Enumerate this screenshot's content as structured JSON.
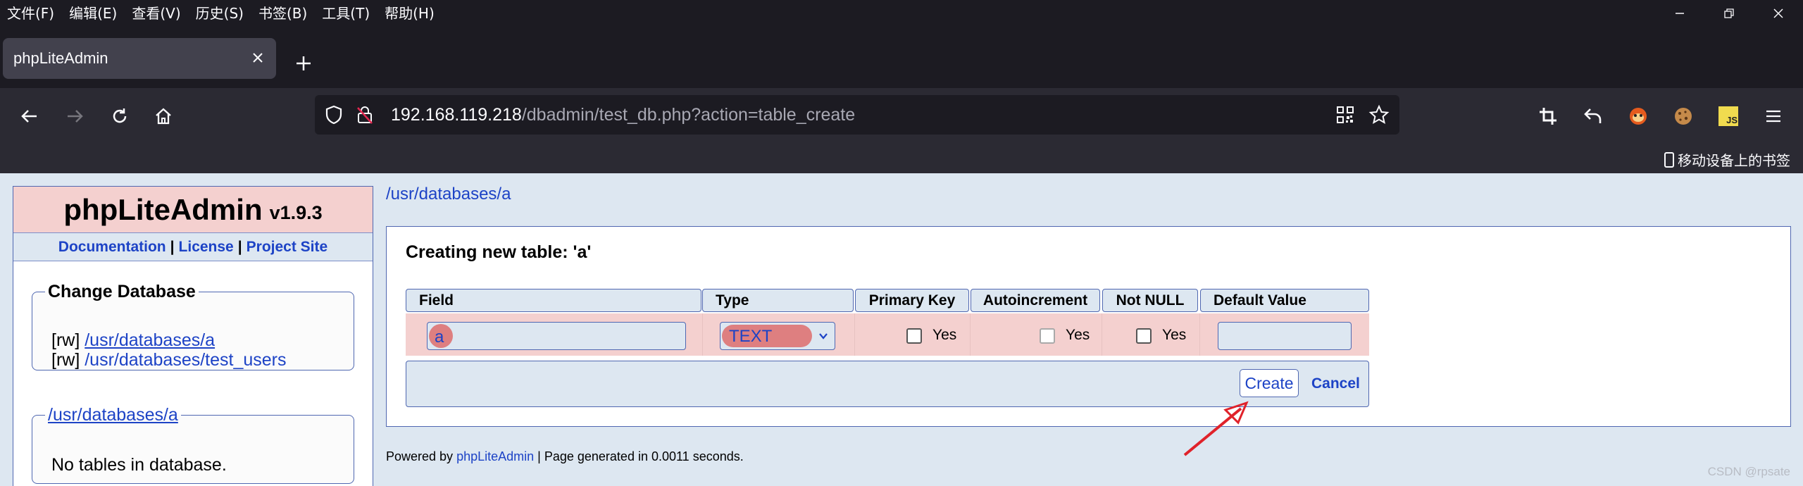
{
  "browser": {
    "menu": [
      "文件(F)",
      "编辑(E)",
      "查看(V)",
      "历史(S)",
      "书签(B)",
      "工具(T)",
      "帮助(H)"
    ],
    "tab_title": "phpLiteAdmin",
    "url_host": "192.168.119.218",
    "url_path": "/dbadmin/test_db.php?action=table_create",
    "bookmark_mobile": "移动设备上的书签",
    "ext_js_label": "JS"
  },
  "sidebar": {
    "app_name": "phpLiteAdmin",
    "version": "v1.9.3",
    "links": [
      "Documentation",
      "License",
      "Project Site"
    ],
    "change_db_title": "Change Database",
    "databases": [
      {
        "mode": "[rw]",
        "path": "/usr/databases/a"
      },
      {
        "mode": "[rw]",
        "path": "/usr/databases/test_users"
      }
    ],
    "current_db": "/usr/databases/a",
    "no_tables": "No tables in database."
  },
  "main": {
    "breadcrumb": "/usr/databases/a",
    "title": "Creating new table: 'a'",
    "columns": [
      "Field",
      "Type",
      "Primary Key",
      "Autoincrement",
      "Not NULL",
      "Default Value"
    ],
    "row": {
      "field_value": "a",
      "type_value": "TEXT",
      "pk_label": "Yes",
      "ai_label": "Yes",
      "nn_label": "Yes",
      "default_value": ""
    },
    "create_label": "Create",
    "cancel_label": "Cancel"
  },
  "footer": {
    "powered_by": "Powered by",
    "link": "phpLiteAdmin",
    "generated": "| Page generated in 0.0011 seconds."
  },
  "watermark": "CSDN @rpsate",
  "colors": {
    "accent": "#1d43c6",
    "border": "#4f67b1",
    "row_highlight": "#f4d0cf",
    "annotation_arrow": "#e0222a"
  }
}
